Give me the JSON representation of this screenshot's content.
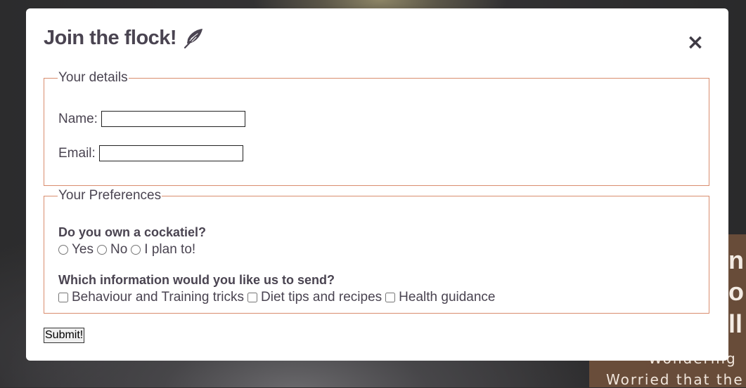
{
  "background": {
    "hero_lines": [
      "n",
      "o",
      "ll"
    ],
    "hero_sub_1": "Wondering",
    "hero_sub_2": "Worried that the"
  },
  "modal": {
    "title": "Join the flock!",
    "title_icon": "feather-icon",
    "close_icon": "close-icon",
    "close_glyph": "×",
    "details": {
      "legend": "Your details",
      "name_label": "Name:",
      "name_value": "",
      "email_label": "Email:",
      "email_value": ""
    },
    "preferences": {
      "legend": "Your Preferences",
      "own_question": "Do you own a cockatiel?",
      "own_options": [
        "Yes",
        "No",
        "I plan to!"
      ],
      "info_question": "Which information would you like us to send?",
      "info_options": [
        "Behaviour and Training tricks",
        "Diet tips and recipes",
        "Health guidance"
      ]
    },
    "submit_label": "Submit!"
  },
  "colors": {
    "text": "#4a4451",
    "fieldset_border": "#d98d6e",
    "hero_block": "#7a563e"
  }
}
